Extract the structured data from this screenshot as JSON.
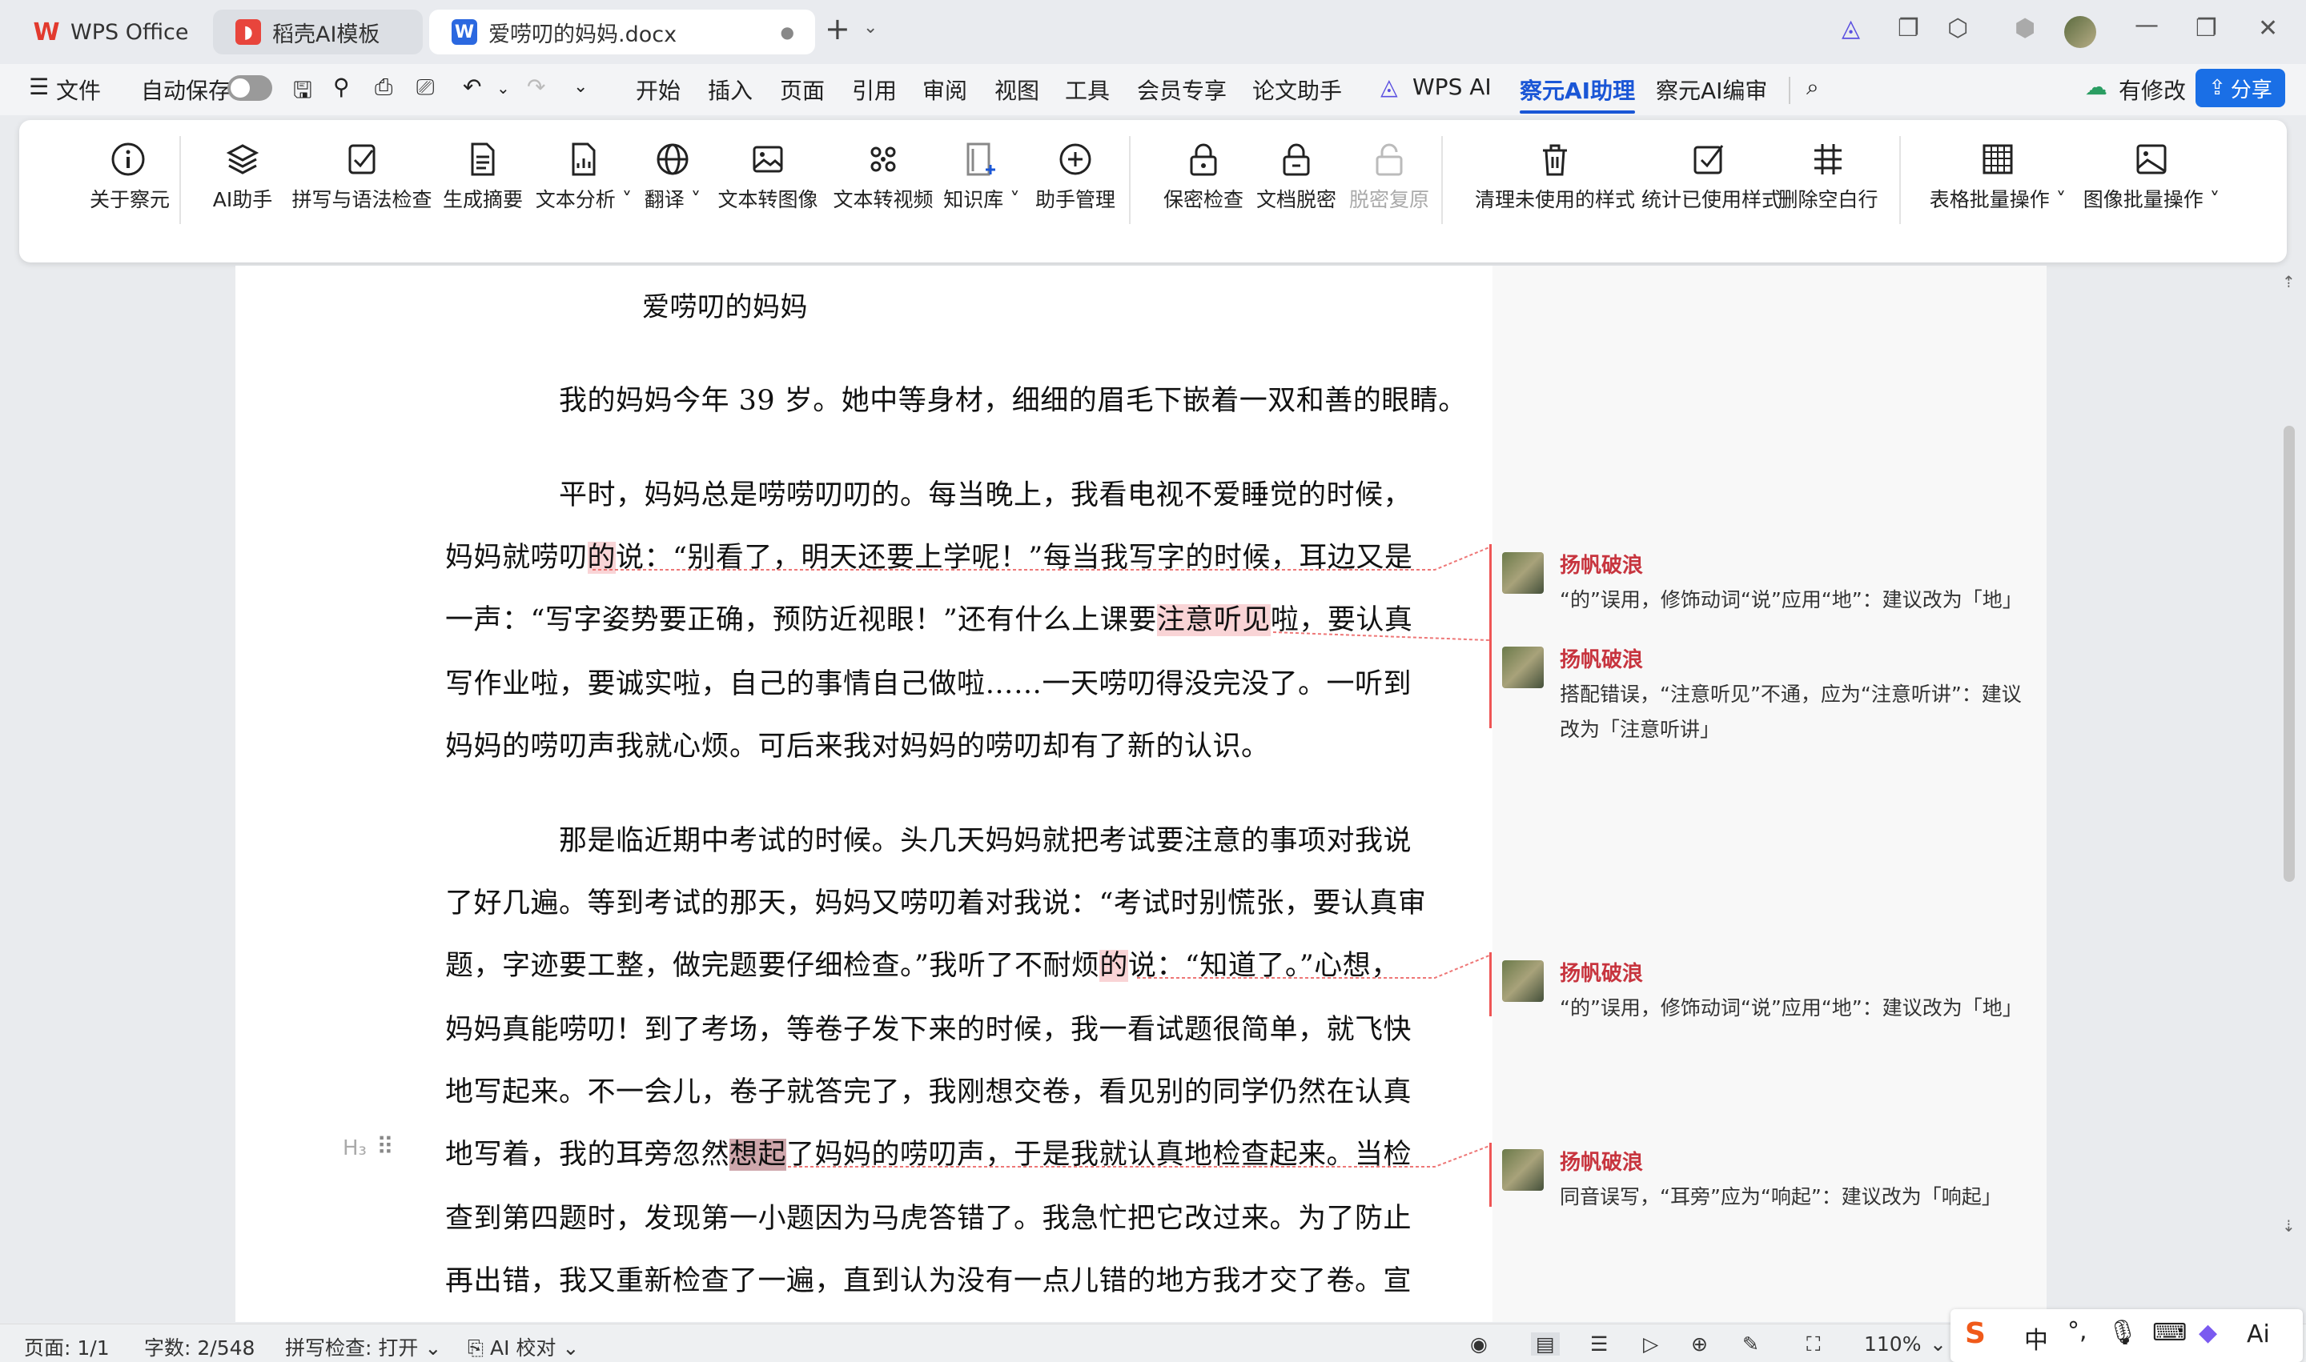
{
  "tabs": [
    {
      "label": "WPS Office",
      "icon": "wps-logo-icon"
    },
    {
      "label": "稻壳AI模板",
      "icon": "daoke-logo-icon"
    },
    {
      "label": "爱唠叨的妈妈.docx",
      "icon": "word-doc-icon"
    }
  ],
  "menu": {
    "file": "文件",
    "autosave": "自动保存",
    "items": [
      "开始",
      "插入",
      "页面",
      "引用",
      "审阅",
      "视图",
      "工具",
      "会员专享",
      "论文助手",
      "WPS AI",
      "察元AI助理",
      "察元AI编审"
    ],
    "active": "察元AI助理",
    "modified": "有修改",
    "share": "分享"
  },
  "ribbon": {
    "items": [
      {
        "label": "关于察元",
        "icon": "info-icon"
      },
      {
        "label": "AI助手",
        "icon": "layers-icon"
      },
      {
        "label": "拼写与语法检查",
        "icon": "check-doc-icon"
      },
      {
        "label": "生成摘要",
        "icon": "document-icon"
      },
      {
        "label": "文本分析",
        "icon": "analysis-icon"
      },
      {
        "label": "翻译",
        "icon": "globe-icon"
      },
      {
        "label": "文本转图像",
        "icon": "image-icon"
      },
      {
        "label": "文本转视频",
        "icon": "video-icon"
      },
      {
        "label": "知识库",
        "icon": "knowledge-icon"
      },
      {
        "label": "助手管理",
        "icon": "plus-circle-icon"
      },
      {
        "label": "保密检查",
        "icon": "lock-icon"
      },
      {
        "label": "文档脱密",
        "icon": "unlock-icon"
      },
      {
        "label": "脱密复原",
        "icon": "restore-icon"
      },
      {
        "label": "清理未使用的样式",
        "icon": "trash-icon"
      },
      {
        "label": "统计已使用样式",
        "icon": "stats-icon"
      },
      {
        "label": "删除空白行",
        "icon": "grid-hash-icon"
      },
      {
        "label": "表格批量操作",
        "icon": "table-icon"
      },
      {
        "label": "图像批量操作",
        "icon": "picture-icon"
      }
    ]
  },
  "document": {
    "title": "爱唠叨的妈妈",
    "lines": {
      "l1": "我的妈妈今年 39 岁。她中等身材，细细的眉毛下嵌着一双和善的眼睛。",
      "l2": "平时，妈妈总是唠唠叨叨的。每当晚上，我看电视不爱睡觉的时候，",
      "l3a": "妈妈就唠叨",
      "l3b": "的",
      "l3c": "说：“别看了，明天还要上学呢！”每当我写字的时候，耳边又是",
      "l4a": "一声：“写字姿势要正确，预防近视眼！”还有什么上课要",
      "l4b": "注意听见",
      "l4c": "啦，要认真",
      "l5": "写作业啦，要诚实啦，自己的事情自己做啦……一天唠叨得没完没了。一听到",
      "l6": "妈妈的唠叨声我就心烦。可后来我对妈妈的唠叨却有了新的认识。",
      "l7": "那是临近期中考试的时候。头几天妈妈就把考试要注意的事项对我说",
      "l8": "了好几遍。等到考试的那天，妈妈又唠叨着对我说：“考试时别慌张，要认真审",
      "l9a": "题，字迹要工整，做完题要仔细检查。”我听了不耐烦",
      "l9b": "的",
      "l9c": "说：“知道了。”心想，",
      "l10": "妈妈真能唠叨！到了考场，等卷子发下来的时候，我一看试题很简单，就飞快",
      "l11": "地写起来。不一会儿，卷子就答完了，我刚想交卷，看见别的同学仍然在认真",
      "l12a": "地写着，我的耳旁忽然",
      "l12b": "想起",
      "l12c": "了妈妈的唠叨声，于是我就认真地检查起来。当检",
      "l13": "查到第四题时，发现第一小题因为马虎答错了。我急忙把它改过来。为了防止",
      "l14": "再出错，我又重新检查了一遍，直到认为没有一点儿错的地方我才交了卷。宣"
    }
  },
  "comments": [
    {
      "author": "扬帆破浪",
      "text": "“的”误用，修饰动词“说”应用“地”：建议改为「地」"
    },
    {
      "author": "扬帆破浪",
      "text": "搭配错误，“注意听见”不通，应为“注意听讲”：建议改为「注意听讲」"
    },
    {
      "author": "扬帆破浪",
      "text": "“的”误用，修饰动词“说”应用“地”：建议改为「地」"
    },
    {
      "author": "扬帆破浪",
      "text": "同音误写，“耳旁”应为“响起”：建议改为「响起」"
    }
  ],
  "status": {
    "page": "页面: 1/1",
    "words": "字数: 2/548",
    "spell": "拼写检查: 打开",
    "ai_check": "AI 校对",
    "zoom": "110%"
  },
  "ime": {
    "lang": "中",
    "ai": "Ai"
  },
  "colors": {
    "accent": "#1a56d6",
    "comment_name": "#c7343e",
    "highlight": "#f9d4d6",
    "share_bg": "#1a6fe6"
  }
}
